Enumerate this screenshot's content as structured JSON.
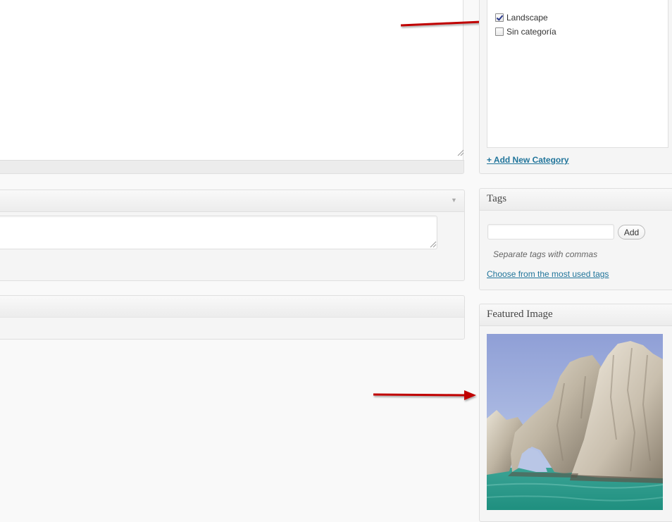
{
  "categories": {
    "items": [
      {
        "label": "Landscape",
        "checked": true
      },
      {
        "label": "Sin categoría",
        "checked": false
      }
    ],
    "add_new_label": "+ Add New Category"
  },
  "tags": {
    "title": "Tags",
    "input_value": "",
    "add_button_label": "Add",
    "howto": "Separate tags with commas",
    "choose_link": "Choose from the most used tags"
  },
  "featured_image": {
    "title": "Featured Image",
    "image_icon": "sea-arch-photo"
  },
  "editor": {
    "toggle_icon": "▼"
  },
  "annotations": {
    "arrow_color": "#c00000"
  },
  "colors": {
    "link": "#21759b",
    "box_border": "#dfdfdf",
    "box_bg": "#f5f5f5"
  }
}
